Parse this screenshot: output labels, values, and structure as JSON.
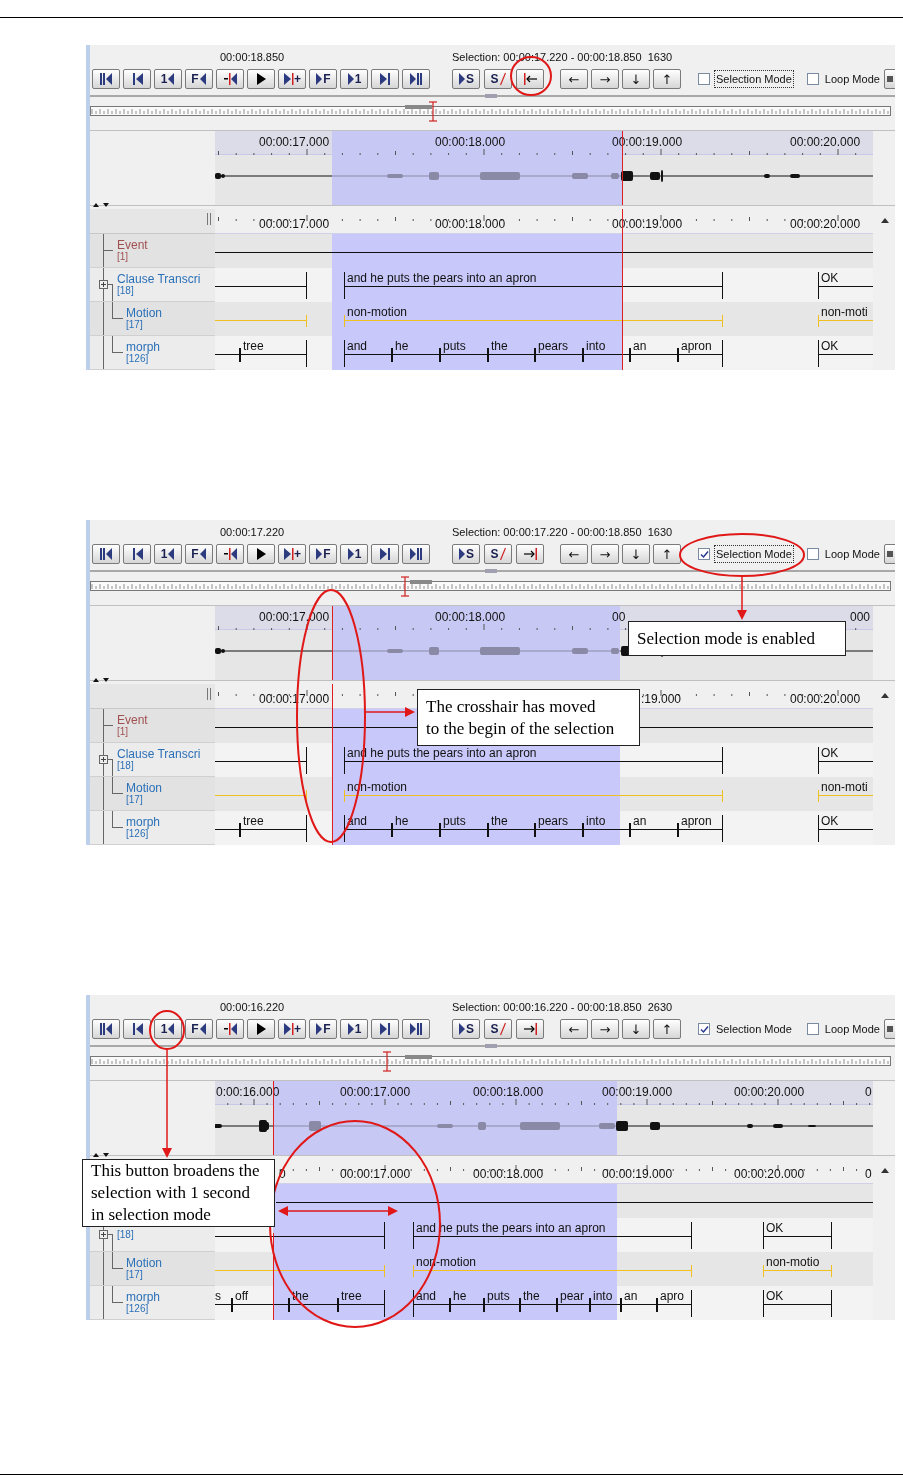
{
  "figures": [
    {
      "time": "00:00:18.850",
      "selection": "Selection: 00:00:17.220 - 00:00:18.850  1630",
      "transport_buttons": [
        {
          "kind": "first"
        },
        {
          "kind": "bar-left"
        },
        {
          "kind": "label-left",
          "label": "1"
        },
        {
          "kind": "label-left",
          "label": "F"
        },
        {
          "kind": "mark-left"
        },
        {
          "kind": "play"
        },
        {
          "kind": "play-mark",
          "label": "+"
        },
        {
          "kind": "right-label",
          "label": "F"
        },
        {
          "kind": "right-label",
          "label": "1"
        },
        {
          "kind": "bar-right"
        },
        {
          "kind": "last"
        }
      ],
      "selection_buttons": [
        {
          "kind": "right-label",
          "label": "S"
        },
        {
          "kind": "clear",
          "label": "S"
        },
        {
          "kind": "to-begin"
        }
      ],
      "arrow_buttons": [
        {
          "kind": "char",
          "label": "←"
        },
        {
          "kind": "char",
          "label": "→"
        },
        {
          "kind": "char",
          "label": "↓"
        },
        {
          "kind": "char",
          "label": "↑"
        }
      ],
      "checkboxes": [
        {
          "label": "Selection Mode",
          "checked": false,
          "focused": true
        },
        {
          "label": "Loop Mode",
          "checked": false,
          "focused": false
        }
      ],
      "waveform_ruler": [
        "00:00:17.000",
        "00:00:18.000",
        "00:00:19.000",
        "00:00:20.000"
      ],
      "timeline_ruler": [
        "00:00:17.000",
        "00:00:18.000",
        "00:00:19.000",
        "00:00:20.000"
      ],
      "tiers": [
        {
          "kind": "event",
          "name": "Event",
          "count": "[1]",
          "color": "#a05050"
        },
        {
          "kind": "clause",
          "name": "Clause Transcri",
          "count": "[18]",
          "color": "#2a70b8",
          "annotations": [
            "and he puts the pears into an apron",
            "OK"
          ],
          "children": [
            {
              "kind": "motion",
              "name": "Motion",
              "count": "[17]",
              "color": "#2a70b8",
              "annotations": [
                "non-motion",
                "non-moti"
              ]
            },
            {
              "kind": "morph",
              "name": "morph",
              "count": "[126]",
              "color": "#2a70b8",
              "annotations": [
                "tree",
                "and",
                "he",
                "puts",
                "the",
                "pears",
                "into",
                "an",
                "apron",
                "OK"
              ]
            }
          ]
        }
      ]
    },
    {
      "time": "00:00:17.220",
      "selection": "Selection: 00:00:17.220 - 00:00:18.850  1630",
      "transport_buttons": [
        {
          "kind": "first"
        },
        {
          "kind": "bar-left"
        },
        {
          "kind": "label-left",
          "label": "1"
        },
        {
          "kind": "label-left",
          "label": "F"
        },
        {
          "kind": "mark-left"
        },
        {
          "kind": "play"
        },
        {
          "kind": "play-mark",
          "label": "+"
        },
        {
          "kind": "right-label",
          "label": "F"
        },
        {
          "kind": "right-label",
          "label": "1"
        },
        {
          "kind": "bar-right"
        },
        {
          "kind": "last"
        }
      ],
      "selection_buttons": [
        {
          "kind": "right-label",
          "label": "S"
        },
        {
          "kind": "clear",
          "label": "S"
        },
        {
          "kind": "to-end"
        }
      ],
      "arrow_buttons": [
        {
          "kind": "char",
          "label": "←"
        },
        {
          "kind": "char",
          "label": "→"
        },
        {
          "kind": "char",
          "label": "↓"
        },
        {
          "kind": "char",
          "label": "↑"
        }
      ],
      "checkboxes": [
        {
          "label": "Selection Mode",
          "checked": true,
          "focused": true
        },
        {
          "label": "Loop Mode",
          "checked": false,
          "focused": false
        }
      ],
      "waveform_ruler": [
        "00:00:17.000",
        "00:00:18.000",
        "00",
        "000"
      ],
      "timeline_ruler": [
        "00:00:17.000",
        ":19.000",
        "00:00:20.000"
      ],
      "tiers": [
        {
          "kind": "event",
          "name": "Event",
          "count": "[1]",
          "color": "#a05050"
        },
        {
          "kind": "clause",
          "name": "Clause Transcri",
          "count": "[18]",
          "color": "#2a70b8",
          "annotations": [
            "and he puts the pears into an apron",
            "OK"
          ],
          "children": [
            {
              "kind": "motion",
              "name": "Motion",
              "count": "[17]",
              "color": "#2a70b8",
              "annotations": [
                "non-motion",
                "non-moti"
              ]
            },
            {
              "kind": "morph",
              "name": "morph",
              "count": "[126]",
              "color": "#2a70b8",
              "annotations": [
                "tree",
                "and",
                "he",
                "puts",
                "the",
                "pears",
                "into",
                "an",
                "apron",
                "OK"
              ]
            }
          ]
        }
      ],
      "callouts": [
        {
          "lines": [
            "Selection mode is enabled"
          ]
        },
        {
          "lines": [
            "The crosshair has moved",
            "to the begin of the selection"
          ]
        }
      ]
    },
    {
      "time": "00:00:16.220",
      "selection": "Selection: 00:00:16.220 - 00:00:18.850  2630",
      "transport_buttons": [
        {
          "kind": "first"
        },
        {
          "kind": "bar-left"
        },
        {
          "kind": "label-left",
          "label": "1"
        },
        {
          "kind": "label-left",
          "label": "F"
        },
        {
          "kind": "mark-left"
        },
        {
          "kind": "play"
        },
        {
          "kind": "play-mark",
          "label": "+"
        },
        {
          "kind": "right-label",
          "label": "F"
        },
        {
          "kind": "right-label",
          "label": "1"
        },
        {
          "kind": "bar-right"
        },
        {
          "kind": "last"
        }
      ],
      "selection_buttons": [
        {
          "kind": "right-label",
          "label": "S"
        },
        {
          "kind": "clear",
          "label": "S"
        },
        {
          "kind": "to-end"
        }
      ],
      "arrow_buttons": [
        {
          "kind": "char",
          "label": "←"
        },
        {
          "kind": "char",
          "label": "→"
        },
        {
          "kind": "char",
          "label": "↓"
        },
        {
          "kind": "char",
          "label": "↑"
        }
      ],
      "checkboxes": [
        {
          "label": "Selection Mode",
          "checked": true,
          "focused": false
        },
        {
          "label": "Loop Mode",
          "checked": false,
          "focused": false
        }
      ],
      "waveform_ruler": [
        "0:00:16.000",
        "00:00:17.000",
        "00:00:18.000",
        "00:00:19.000",
        "00:00:20.000",
        "0"
      ],
      "timeline_ruler": [
        "0",
        "00:00:17.000",
        "00:00:18.000",
        "00:00:19.000",
        "00:00:20.000",
        "0"
      ],
      "tiers": [
        {
          "kind": "event"
        },
        {
          "kind": "clause",
          "count": "[18]",
          "color": "#2a70b8",
          "annotations": [
            "and he puts the pears into an apron",
            "OK"
          ],
          "children": [
            {
              "kind": "motion",
              "name": "Motion",
              "count": "[17]",
              "color": "#2a70b8",
              "annotations": [
                "non-motion",
                "non-motio"
              ]
            },
            {
              "kind": "morph",
              "name": "morph",
              "count": "[126]",
              "color": "#2a70b8",
              "annotations": [
                "s",
                "off",
                "the",
                "tree",
                "and",
                "he",
                "puts",
                "the",
                "pear",
                "into",
                "an",
                "apro",
                "OK"
              ]
            }
          ]
        }
      ],
      "callouts": [
        {
          "lines": [
            "This button broadens the",
            "selection with 1 second",
            "in selection mode"
          ]
        }
      ]
    }
  ]
}
